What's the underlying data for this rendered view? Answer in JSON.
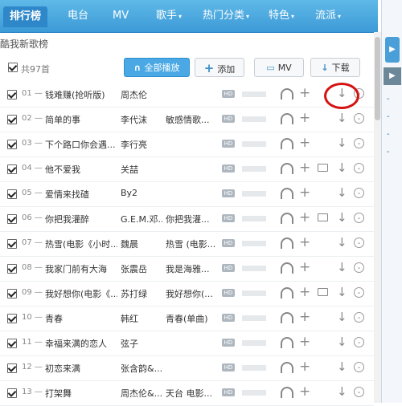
{
  "nav": {
    "tabs": [
      {
        "label": "排行榜",
        "active": true
      },
      {
        "label": "电台"
      },
      {
        "label": "MV"
      },
      {
        "label": "歌手",
        "dropdown": true
      },
      {
        "label": "热门分类",
        "dropdown": true
      },
      {
        "label": "特色",
        "dropdown": true
      },
      {
        "label": "流派",
        "dropdown": true
      }
    ],
    "caret": "▾"
  },
  "chart": {
    "title": "酷我新歌榜",
    "total": "共97首"
  },
  "toolbar": {
    "play_all": "全部播放",
    "add": "添加",
    "mv": "MV",
    "download": "下载"
  },
  "icons": {
    "hd": "HD",
    "plus": "+",
    "download": "↓",
    "more": "⌄",
    "headphone": "headphone-icon",
    "mv": "mv-icon"
  },
  "songs": [
    {
      "num": "01 —",
      "title": "钱难赚(抢听版)",
      "artist": "周杰伦",
      "album": "",
      "mv": false,
      "highlight": true
    },
    {
      "num": "02 —",
      "title": "简单的事",
      "artist": "李代沫",
      "album": "敏感情歌...",
      "mv": false
    },
    {
      "num": "03 —",
      "title": "下个路口你会遇...",
      "artist": "李行亮",
      "album": "",
      "mv": false
    },
    {
      "num": "04 —",
      "title": "他不爱我",
      "artist": "关喆",
      "album": "",
      "mv": true
    },
    {
      "num": "05 —",
      "title": "爱情来找碴",
      "artist": "By2",
      "album": "",
      "mv": false
    },
    {
      "num": "06 —",
      "title": "你把我灌醉",
      "artist": "G.E.M.邓...",
      "album": "你把我灌...",
      "mv": true
    },
    {
      "num": "07 —",
      "title": "热雪(电影《小时...",
      "artist": "魏晨",
      "album": "热雪 (电影...",
      "mv": false
    },
    {
      "num": "08 —",
      "title": "我家门前有大海",
      "artist": "张震岳",
      "album": "我是海雅...",
      "mv": false
    },
    {
      "num": "09 —",
      "title": "我好想你(电影《...",
      "artist": "苏打绿",
      "album": "我好想你(...",
      "mv": true
    },
    {
      "num": "10 —",
      "title": "青春",
      "artist": "韩红",
      "album": "青春(单曲)",
      "mv": false
    },
    {
      "num": "11 —",
      "title": "幸福来满的恋人",
      "artist": "弦子",
      "album": "",
      "mv": false
    },
    {
      "num": "12 —",
      "title": "初恋来满",
      "artist": "张含韵&...",
      "album": "",
      "mv": false
    },
    {
      "num": "13 —",
      "title": "打架舞",
      "artist": "周杰伦&...",
      "album": "天台 电影...",
      "mv": false
    }
  ]
}
